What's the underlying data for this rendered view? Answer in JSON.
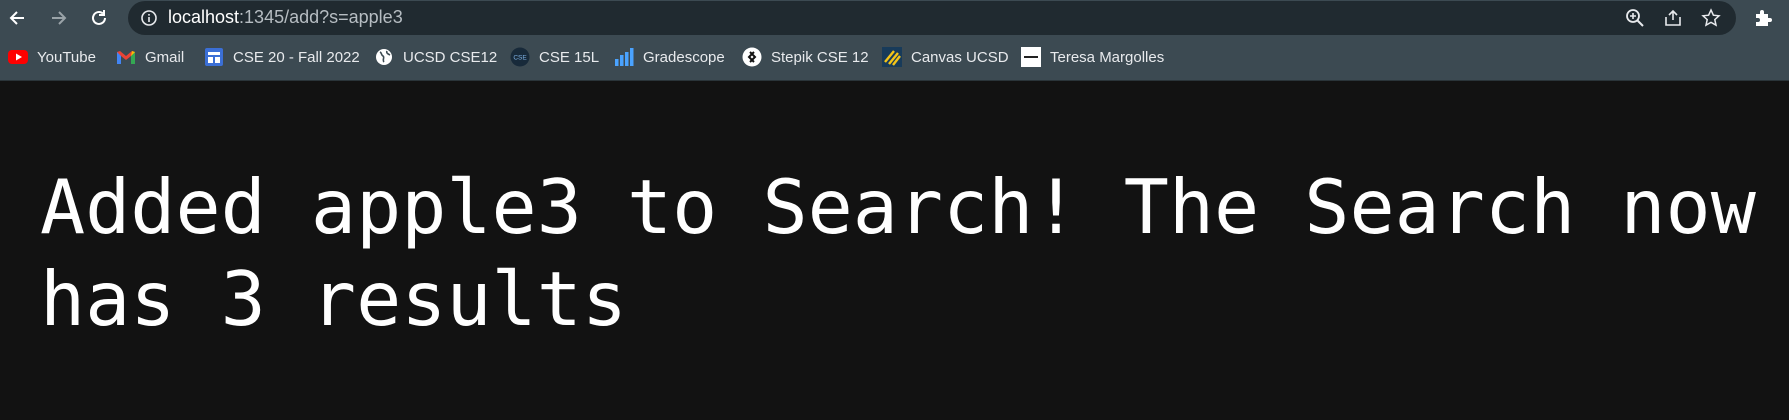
{
  "browser": {
    "url_host": "localhost",
    "url_path": ":1345/add?s=apple3"
  },
  "bookmarks": [
    {
      "label": "YouTube",
      "icon": "youtube-icon"
    },
    {
      "label": "Gmail",
      "icon": "gmail-icon"
    },
    {
      "label": "CSE 20 - Fall 2022",
      "icon": "calendar-board-icon"
    },
    {
      "label": "UCSD CSE12",
      "icon": "globe-icon"
    },
    {
      "label": "CSE 15L",
      "icon": "cse-logo-icon"
    },
    {
      "label": "Gradescope",
      "icon": "bar-chart-icon"
    },
    {
      "label": "Stepik CSE 12",
      "icon": "stepik-icon"
    },
    {
      "label": "Canvas UCSD",
      "icon": "canvas-icon"
    },
    {
      "label": "Teresa Margolles",
      "icon": "artsy-icon"
    }
  ],
  "page": {
    "message": "Added apple3 to Search! The Search now has 3 results"
  }
}
